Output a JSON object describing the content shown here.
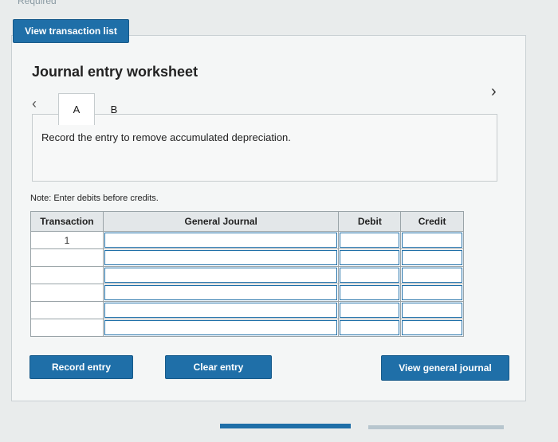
{
  "top_cut_text": "Required",
  "view_transaction_list_label": "View transaction list",
  "worksheet_title": "Journal entry worksheet",
  "tabs": [
    {
      "label": "A"
    },
    {
      "label": "B"
    }
  ],
  "instruction": "Record the entry to remove accumulated depreciation.",
  "note": "Note: Enter debits before credits.",
  "table": {
    "headers": [
      "Transaction",
      "General Journal",
      "Debit",
      "Credit"
    ],
    "rows": [
      {
        "transaction": "1"
      },
      {
        "transaction": ""
      },
      {
        "transaction": ""
      },
      {
        "transaction": ""
      },
      {
        "transaction": ""
      },
      {
        "transaction": ""
      }
    ]
  },
  "buttons": {
    "record_entry": "Record entry",
    "clear_entry": "Clear entry",
    "view_general_journal": "View general journal"
  },
  "colors": {
    "accent": "#1f6fa8",
    "panel": "#f4f6f6"
  }
}
